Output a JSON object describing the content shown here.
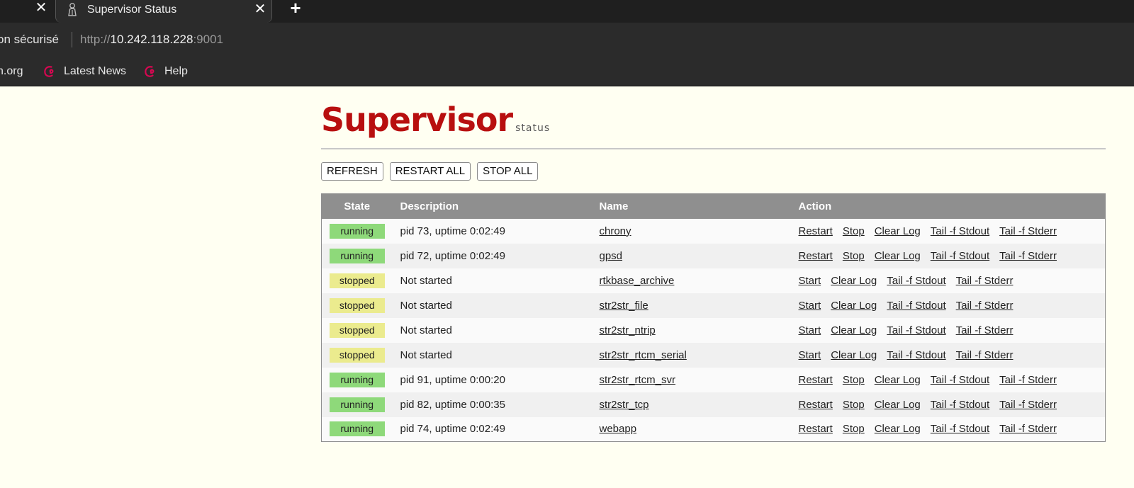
{
  "browser": {
    "prev_tab_close": "✕",
    "active_tab": {
      "title": "Supervisor Status",
      "close": "✕"
    },
    "new_tab": "+",
    "security_text": "on sécurisé",
    "url": {
      "scheme": "http://",
      "host": "10.242.118.228",
      "port": ":9001"
    },
    "bookmarks": [
      {
        "label": "n.org",
        "icon": "none"
      },
      {
        "label": "Latest News",
        "icon": "debian-swirl-icon"
      },
      {
        "label": "Help",
        "icon": "debian-swirl-icon"
      }
    ]
  },
  "page": {
    "logo_main": "Supervisor",
    "logo_sub": "status",
    "buttons": {
      "refresh": "REFRESH",
      "restart_all": "RESTART ALL",
      "stop_all": "STOP ALL"
    },
    "table": {
      "headers": {
        "state": "State",
        "description": "Description",
        "name": "Name",
        "action": "Action"
      },
      "rows": [
        {
          "state": "running",
          "description": "pid 73, uptime 0:02:49",
          "name": "chrony",
          "actions": [
            "Restart",
            "Stop",
            "Clear Log",
            "Tail -f Stdout",
            "Tail -f Stderr"
          ]
        },
        {
          "state": "running",
          "description": "pid 72, uptime 0:02:49",
          "name": "gpsd",
          "actions": [
            "Restart",
            "Stop",
            "Clear Log",
            "Tail -f Stdout",
            "Tail -f Stderr"
          ]
        },
        {
          "state": "stopped",
          "description": "Not started",
          "name": "rtkbase_archive",
          "actions": [
            "Start",
            "Clear Log",
            "Tail -f Stdout",
            "Tail -f Stderr"
          ]
        },
        {
          "state": "stopped",
          "description": "Not started",
          "name": "str2str_file",
          "actions": [
            "Start",
            "Clear Log",
            "Tail -f Stdout",
            "Tail -f Stderr"
          ]
        },
        {
          "state": "stopped",
          "description": "Not started",
          "name": "str2str_ntrip",
          "actions": [
            "Start",
            "Clear Log",
            "Tail -f Stdout",
            "Tail -f Stderr"
          ]
        },
        {
          "state": "stopped",
          "description": "Not started",
          "name": "str2str_rtcm_serial",
          "actions": [
            "Start",
            "Clear Log",
            "Tail -f Stdout",
            "Tail -f Stderr"
          ]
        },
        {
          "state": "running",
          "description": "pid 91, uptime 0:00:20",
          "name": "str2str_rtcm_svr",
          "actions": [
            "Restart",
            "Stop",
            "Clear Log",
            "Tail -f Stdout",
            "Tail -f Stderr"
          ]
        },
        {
          "state": "running",
          "description": "pid 82, uptime 0:00:35",
          "name": "str2str_tcp",
          "actions": [
            "Restart",
            "Stop",
            "Clear Log",
            "Tail -f Stdout",
            "Tail -f Stderr"
          ]
        },
        {
          "state": "running",
          "description": "pid 74, uptime 0:02:49",
          "name": "webapp",
          "actions": [
            "Restart",
            "Stop",
            "Clear Log",
            "Tail -f Stdout",
            "Tail -f Stderr"
          ]
        }
      ]
    }
  },
  "colors": {
    "logo": "#b80f0f",
    "running": "#8ed97a",
    "stopped": "#ebeb8e",
    "header": "#8f8f8f",
    "page_bg": "#fffff2"
  }
}
